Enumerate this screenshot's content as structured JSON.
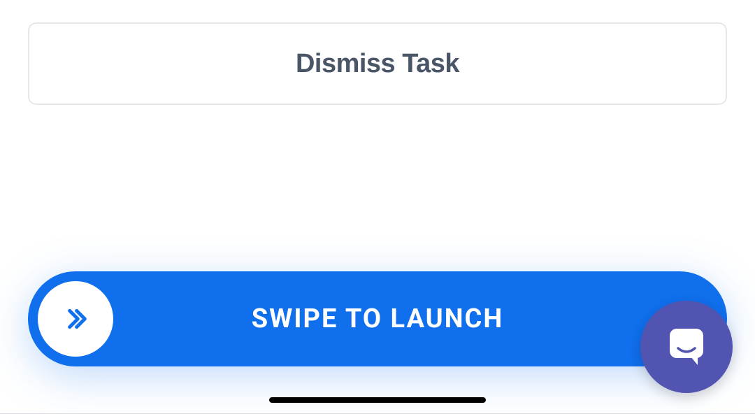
{
  "dismiss": {
    "label": "Dismiss Task"
  },
  "swipe": {
    "label": "SWIPE TO LAUNCH"
  },
  "colors": {
    "primary": "#106fed",
    "fab": "#5254b2",
    "border": "#e5e7eb",
    "text": "#4a5568"
  }
}
